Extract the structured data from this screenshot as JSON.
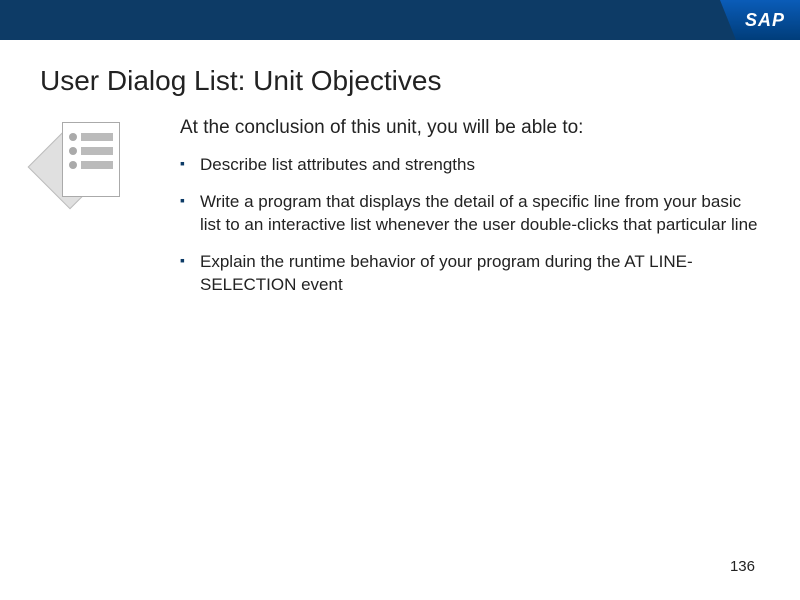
{
  "logo": "SAP",
  "title": "User Dialog List: Unit Objectives",
  "intro": "At the conclusion of this unit, you will be able to:",
  "objectives": [
    "Describe list attributes and strengths",
    "Write a program that displays the detail of a specific line from your basic list to an interactive list whenever the user double-clicks that particular line",
    "Explain the runtime behavior of your program during the AT LINE-SELECTION event"
  ],
  "page_number": "136"
}
